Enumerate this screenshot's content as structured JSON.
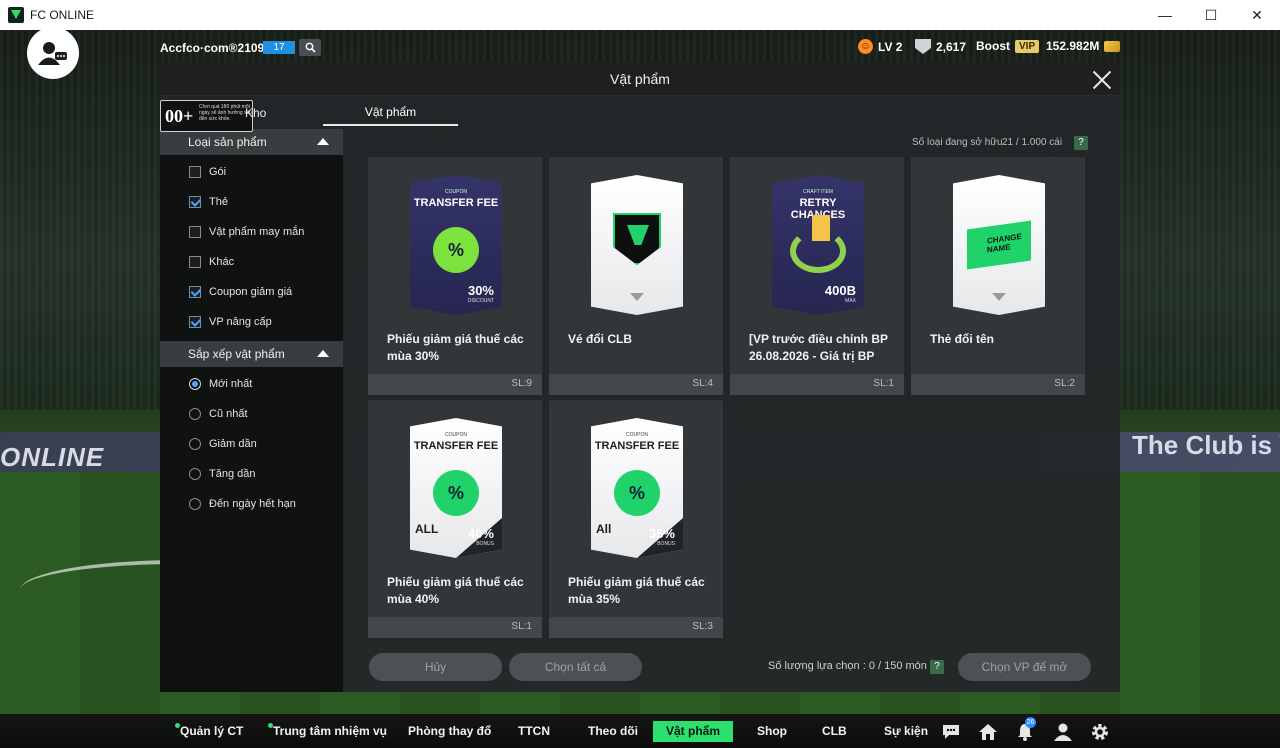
{
  "window": {
    "title": "FC ONLINE",
    "minimize": "—",
    "maximize": "☐",
    "close": "✕"
  },
  "hud": {
    "username": "Accfco·com®2109o",
    "user_badge": "17",
    "level": "LV 2",
    "rank_value": "2,617",
    "boost_label": "Boost",
    "vip_label": "VIP",
    "currency": "152.982M"
  },
  "modal": {
    "title": "Vật phẩm",
    "age_rating": "00+",
    "age_notice": "Chơi quá 180 phút một ngày sẽ ảnh hưởng xấu đến sức khỏe.",
    "tab_kho": "Kho",
    "tab_vatpham": "Vật phẩm",
    "owned_label": "Số loại đang sở hữu",
    "owned_value": "21 / 1.000 cái",
    "help": "?"
  },
  "filters": {
    "product_type_header": "Loại sản phẩm",
    "product_types": [
      {
        "label": "Gói",
        "checked": false
      },
      {
        "label": "Thẻ",
        "checked": true
      },
      {
        "label": "Vật phẩm may mắn",
        "checked": false
      },
      {
        "label": "Khác",
        "checked": false
      },
      {
        "label": "Coupon giảm giá",
        "checked": true
      },
      {
        "label": "VP nâng cấp",
        "checked": true
      }
    ],
    "sort_header": "Sắp xếp vật phẩm",
    "sort_options": [
      {
        "label": "Mới nhất",
        "selected": true
      },
      {
        "label": "Cũ nhất",
        "selected": false
      },
      {
        "label": "Giảm dần",
        "selected": false
      },
      {
        "label": "Tăng dần",
        "selected": false
      },
      {
        "label": "Đến ngày hết hạn",
        "selected": false
      }
    ]
  },
  "items": [
    {
      "name": "Phiếu giảm giá thuế các mùa 30%",
      "qty": "SL:9",
      "art": {
        "kind": "coupon-dark",
        "top": "COUPON",
        "title": "TRANSFER FEE",
        "seal": "%",
        "pct": "30%",
        "pct_sub": "DISCOUNT"
      }
    },
    {
      "name": "Vé đổi CLB",
      "qty": "SL:4",
      "art": {
        "kind": "club-white"
      }
    },
    {
      "name": "[VP trước điều chỉnh BP 26.08.2026 - Giá trị BP",
      "qty": "SL:1",
      "art": {
        "kind": "retry-dark",
        "top": "CRAFT ITEM",
        "title": "RETRY CHANCES",
        "pct": "400B",
        "pct_sub": "MAX"
      }
    },
    {
      "name": "Thẻ đổi tên",
      "qty": "SL:2",
      "art": {
        "kind": "name-white",
        "label": "CHANGE NAME"
      }
    },
    {
      "name": "Phiếu giảm giá thuế các mùa 40%",
      "qty": "SL:1",
      "art": {
        "kind": "coupon-white",
        "top": "COUPON",
        "title": "TRANSFER FEE",
        "seal": "%",
        "all": "ALL",
        "pct": "40%",
        "pct_sub": "BONUS"
      }
    },
    {
      "name": "Phiếu giảm giá thuế các mùa 35%",
      "qty": "SL:3",
      "art": {
        "kind": "coupon-white",
        "top": "COUPON",
        "title": "TRANSFER FEE",
        "seal": "%",
        "all": "All",
        "pct": "35%",
        "pct_sub": "BONUS"
      }
    }
  ],
  "footer": {
    "cancel": "Hủy",
    "select_all": "Chọn tất cả",
    "select_count": "Số lượng lựa chọn : 0 / 150 món",
    "open_item": "Chọn VP để mở"
  },
  "background": {
    "banner_left": "ONLINE",
    "banner_right": "The Club is Y"
  },
  "nav": {
    "items": [
      {
        "label": "Quản lý CT",
        "dot": true,
        "active": false
      },
      {
        "label": "Trung tâm nhiệm vụ",
        "dot": true,
        "active": false
      },
      {
        "label": "Phòng thay đổ",
        "dot": false,
        "active": false
      },
      {
        "label": "TTCN",
        "dot": false,
        "active": false
      },
      {
        "label": "Theo dõi",
        "dot": false,
        "active": false
      },
      {
        "label": "Vật phẩm",
        "dot": false,
        "active": true
      },
      {
        "label": "Shop",
        "dot": false,
        "active": false
      },
      {
        "label": "CLB",
        "dot": false,
        "active": false
      },
      {
        "label": "Sự kiện",
        "dot": false,
        "active": false
      }
    ],
    "notification_count": "26",
    "icons": [
      "chat-icon",
      "home-icon",
      "bell-icon",
      "profile-icon",
      "gear-icon"
    ]
  },
  "colors": {
    "accent": "#2de06e",
    "checkbox": "#4aa8ff",
    "vip": "#e5c96a"
  }
}
